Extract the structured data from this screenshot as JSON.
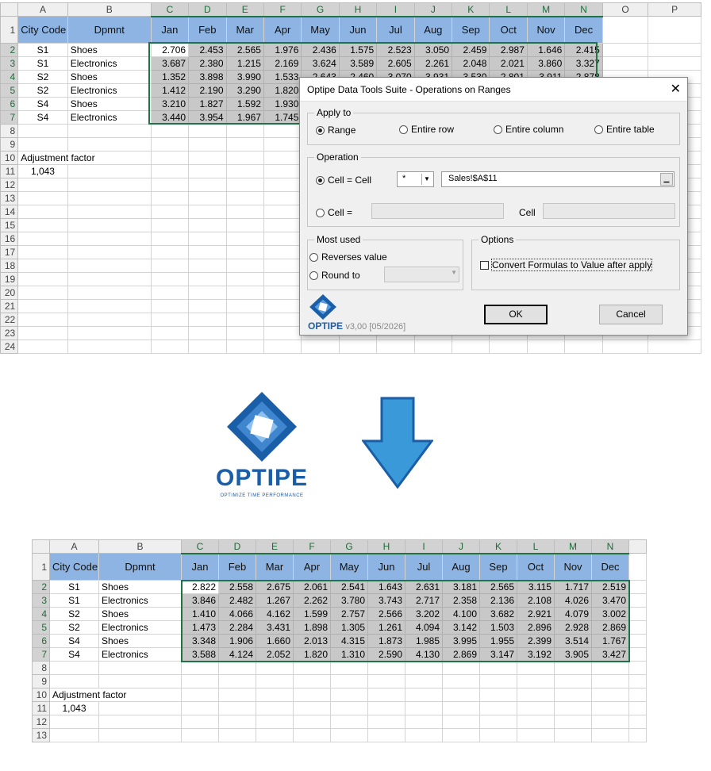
{
  "columns_before": [
    "A",
    "B",
    "C",
    "D",
    "E",
    "F",
    "G",
    "H",
    "I",
    "J",
    "K",
    "L",
    "M",
    "N",
    "O",
    "P"
  ],
  "columns_after": [
    "A",
    "B",
    "C",
    "D",
    "E",
    "F",
    "G",
    "H",
    "I",
    "J",
    "K",
    "L",
    "M",
    "N"
  ],
  "header": {
    "city_code": "City Code",
    "dpmnt": "Dpmnt",
    "months": [
      "Jan",
      "Feb",
      "Mar",
      "Apr",
      "May",
      "Jun",
      "Jul",
      "Aug",
      "Sep",
      "Oct",
      "Nov",
      "Dec"
    ]
  },
  "labels": {
    "adjustment_factor": "Adjustment factor",
    "factor_value": "1,043"
  },
  "rows_before": [
    {
      "city": "S1",
      "dept": "Shoes",
      "vals": [
        "2.706",
        "2.453",
        "2.565",
        "1.976",
        "2.436",
        "1.575",
        "2.523",
        "3.050",
        "2.459",
        "2.987",
        "1.646",
        "2.415"
      ]
    },
    {
      "city": "S1",
      "dept": "Electronics",
      "vals": [
        "3.687",
        "2.380",
        "1.215",
        "2.169",
        "3.624",
        "3.589",
        "2.605",
        "2.261",
        "2.048",
        "2.021",
        "3.860",
        "3.327"
      ]
    },
    {
      "city": "S2",
      "dept": "Shoes",
      "vals": [
        "1.352",
        "3.898",
        "3.990",
        "1.533",
        "2.643",
        "2.460",
        "3.070",
        "3.931",
        "3.530",
        "2.801",
        "3.911",
        "2.878"
      ]
    },
    {
      "city": "S2",
      "dept": "Electronics",
      "vals": [
        "1.412",
        "2.190",
        "3.290",
        "1.820",
        "",
        "",
        "",
        "",
        "",
        "",
        "",
        ""
      ]
    },
    {
      "city": "S4",
      "dept": "Shoes",
      "vals": [
        "3.210",
        "1.827",
        "1.592",
        "1.930",
        "",
        "",
        "",
        "",
        "",
        "",
        "",
        ""
      ]
    },
    {
      "city": "S4",
      "dept": "Electronics",
      "vals": [
        "3.440",
        "3.954",
        "1.967",
        "1.745",
        "",
        "",
        "",
        "",
        "",
        "",
        "",
        ""
      ]
    }
  ],
  "rows_after": [
    {
      "city": "S1",
      "dept": "Shoes",
      "vals": [
        "2.822",
        "2.558",
        "2.675",
        "2.061",
        "2.541",
        "1.643",
        "2.631",
        "3.181",
        "2.565",
        "3.115",
        "1.717",
        "2.519"
      ]
    },
    {
      "city": "S1",
      "dept": "Electronics",
      "vals": [
        "3.846",
        "2.482",
        "1.267",
        "2.262",
        "3.780",
        "3.743",
        "2.717",
        "2.358",
        "2.136",
        "2.108",
        "4.026",
        "3.470"
      ]
    },
    {
      "city": "S2",
      "dept": "Shoes",
      "vals": [
        "1.410",
        "4.066",
        "4.162",
        "1.599",
        "2.757",
        "2.566",
        "3.202",
        "4.100",
        "3.682",
        "2.921",
        "4.079",
        "3.002"
      ]
    },
    {
      "city": "S2",
      "dept": "Electronics",
      "vals": [
        "1.473",
        "2.284",
        "3.431",
        "1.898",
        "1.305",
        "1.261",
        "4.094",
        "3.142",
        "1.503",
        "2.896",
        "2.928",
        "2.869"
      ]
    },
    {
      "city": "S4",
      "dept": "Shoes",
      "vals": [
        "3.348",
        "1.906",
        "1.660",
        "2.013",
        "4.315",
        "1.873",
        "1.985",
        "3.995",
        "1.955",
        "2.399",
        "3.514",
        "1.767"
      ]
    },
    {
      "city": "S4",
      "dept": "Electronics",
      "vals": [
        "3.588",
        "4.124",
        "2.052",
        "1.820",
        "1.310",
        "2.590",
        "4.130",
        "2.869",
        "3.147",
        "3.192",
        "3.905",
        "3.427"
      ]
    }
  ],
  "dialog": {
    "title": "Optipe Data Tools Suite - Operations on Ranges",
    "close": "✕",
    "apply_to": "Apply to",
    "range": "Range",
    "entire_row": "Entire row",
    "entire_column": "Entire column",
    "entire_table": "Entire table",
    "operation": "Operation",
    "cell_eq_cell": "Cell = Cell",
    "operator": "*",
    "reference": "Sales!$A$11",
    "cell_eq": "Cell =",
    "cell": "Cell",
    "most_used": "Most used",
    "reverses_value": "Reverses value",
    "round_to": "Round to",
    "options": "Options",
    "convert_formulas": "Convert Formulas to Value after apply",
    "ok": "OK",
    "cancel": "Cancel",
    "brand": "OPTIPE",
    "version": "v3,00 [05/2026]"
  },
  "big_logo": {
    "brand": "OPTIPE",
    "tagline": "OPTIMIZE TIME PERFORMANCE"
  },
  "colors": {
    "header_blue": "#8db4e2",
    "selection_green": "#217346",
    "arrow_blue": "#3a9ad9",
    "logo_blue": "#1b5ea8"
  }
}
